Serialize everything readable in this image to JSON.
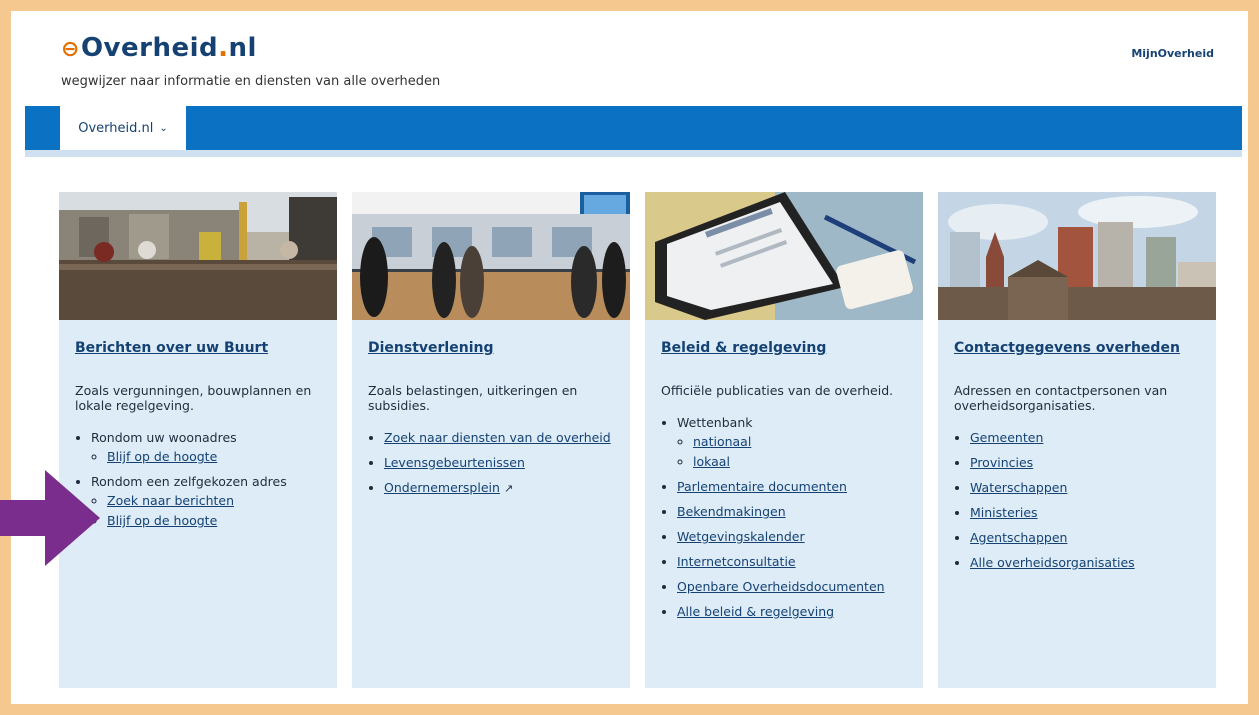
{
  "header": {
    "logo_text": "Overheid",
    "logo_dot": ".",
    "logo_tld": "nl",
    "tagline": "wegwijzer naar informatie en diensten van alle overheden",
    "mijn_link": "MijnOverheid"
  },
  "nav": {
    "tab_label": "Overheid.nl"
  },
  "cards": [
    {
      "title": "Berichten over uw Buurt",
      "intro": "Zoals vergunningen, bouwplannen en lokale regelgeving.",
      "groups": [
        {
          "label": "Rondom uw woonadres",
          "links": [
            "Blijf op de hoogte"
          ]
        },
        {
          "label": "Rondom een zelfgekozen adres",
          "links": [
            "Zoek naar berichten",
            "Blijf op de hoogte"
          ]
        }
      ]
    },
    {
      "title": "Dienstverlening",
      "intro": "Zoals belastingen, uitkeringen en subsidies.",
      "links": [
        "Zoek naar diensten van de overheid",
        "Levensgebeurtenissen",
        "Ondernemersplein"
      ]
    },
    {
      "title": "Beleid & regelgeving",
      "intro": "Officiële publicaties van de overheid.",
      "wettenbank": {
        "label": "Wettenbank",
        "links": [
          "nationaal",
          "lokaal"
        ]
      },
      "links": [
        "Parlementaire documenten",
        "Bekendmakingen",
        "Wetgevingskalender",
        "Internetconsultatie",
        "Openbare Overheidsdocumenten",
        "Alle beleid & regelgeving"
      ]
    },
    {
      "title": "Contactgegevens overheden",
      "intro": "Adressen en contactpersonen van overheidsorganisaties.",
      "links": [
        "Gemeenten",
        "Provincies",
        "Waterschappen",
        "Ministeries",
        "Agentschappen",
        "Alle overheidsorganisaties"
      ]
    }
  ],
  "colors": {
    "brand_blue": "#154273",
    "nav_blue": "#0b71c2",
    "card_bg": "#deecf7",
    "frame_border": "#f5c88f",
    "arrow": "#7b2d8e"
  },
  "icons": {
    "nav_chevron": "chevron-down-icon",
    "external_link": "external-link-icon",
    "annotation": "arrow-right-icon"
  }
}
